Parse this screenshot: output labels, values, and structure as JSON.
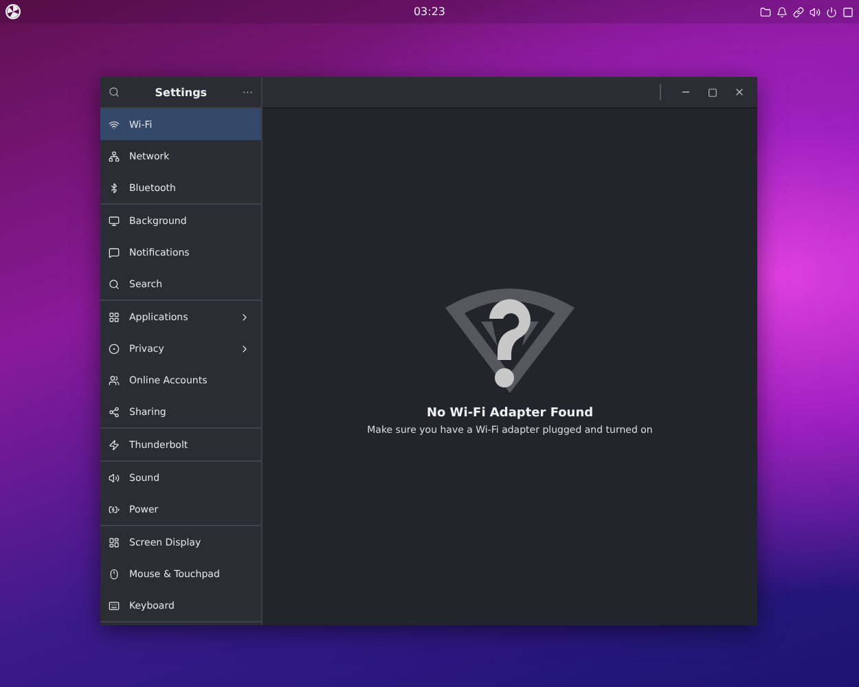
{
  "top_bar": {
    "clock": "03:23"
  },
  "window": {
    "title": "Settings",
    "more": "···"
  },
  "sidebar": {
    "sections": [
      {
        "items": [
          {
            "label": "Wi-Fi",
            "selected": true,
            "submenu": false
          },
          {
            "label": "Network",
            "selected": false,
            "submenu": false
          },
          {
            "label": "Bluetooth",
            "selected": false,
            "submenu": false
          }
        ]
      },
      {
        "items": [
          {
            "label": "Background",
            "selected": false,
            "submenu": false
          },
          {
            "label": "Notifications",
            "selected": false,
            "submenu": false
          },
          {
            "label": "Search",
            "selected": false,
            "submenu": false
          }
        ]
      },
      {
        "items": [
          {
            "label": "Applications",
            "selected": false,
            "submenu": true
          },
          {
            "label": "Privacy",
            "selected": false,
            "submenu": true
          },
          {
            "label": "Online Accounts",
            "selected": false,
            "submenu": false
          },
          {
            "label": "Sharing",
            "selected": false,
            "submenu": false
          }
        ]
      },
      {
        "items": [
          {
            "label": "Thunderbolt",
            "selected": false,
            "submenu": false
          }
        ]
      },
      {
        "items": [
          {
            "label": "Sound",
            "selected": false,
            "submenu": false
          },
          {
            "label": "Power",
            "selected": false,
            "submenu": false
          }
        ]
      },
      {
        "items": [
          {
            "label": "Screen Display",
            "selected": false,
            "submenu": false
          },
          {
            "label": "Mouse & Touchpad",
            "selected": false,
            "submenu": false
          },
          {
            "label": "Keyboard",
            "selected": false,
            "submenu": false
          }
        ]
      }
    ]
  },
  "content": {
    "title": "No Wi-Fi Adapter Found",
    "message": "Make sure you have a Wi-Fi adapter plugged and turned on"
  }
}
